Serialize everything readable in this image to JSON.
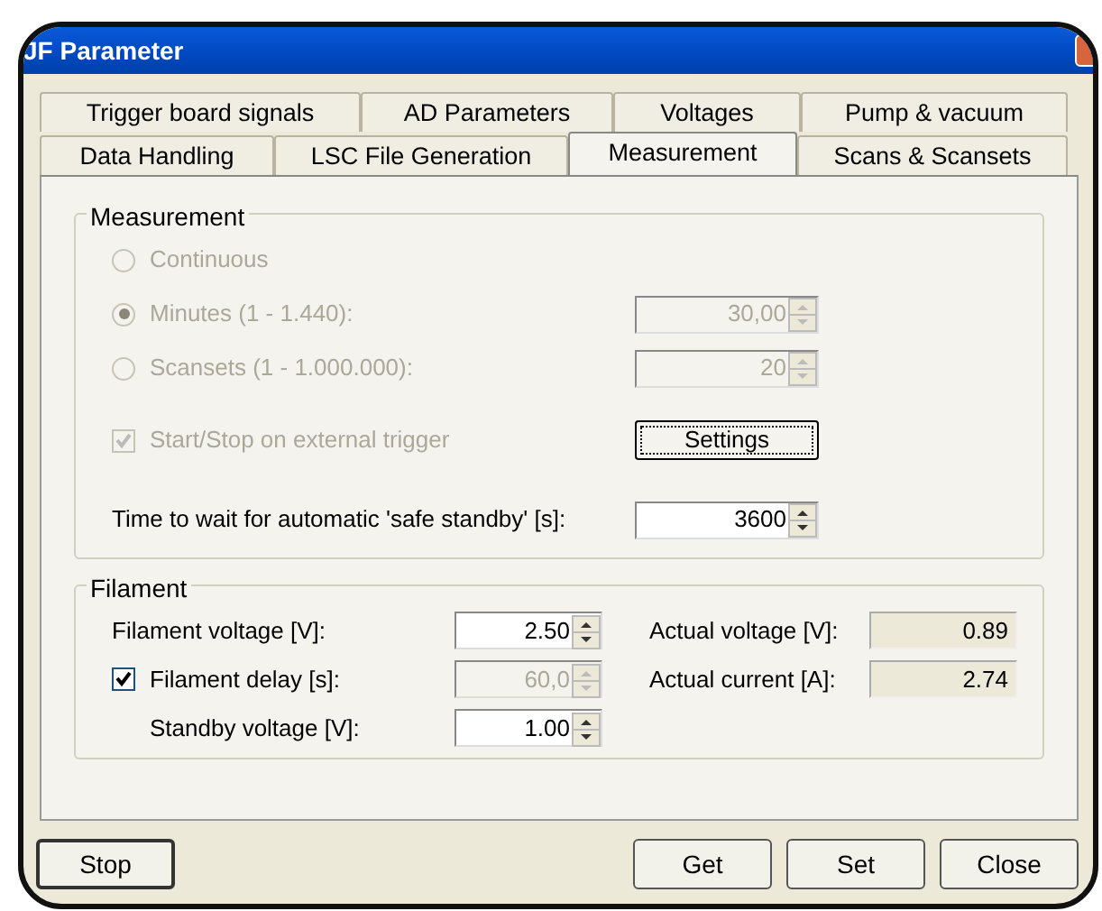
{
  "window": {
    "title": "JF Parameter"
  },
  "tab_rows": [
    [
      {
        "label": "Trigger board signals",
        "selected": false
      },
      {
        "label": "AD Parameters",
        "selected": false
      },
      {
        "label": "Voltages",
        "selected": false
      },
      {
        "label": "Pump & vacuum",
        "selected": false
      }
    ],
    [
      {
        "label": "Data Handling",
        "selected": false
      },
      {
        "label": "LSC File Generation",
        "selected": false
      },
      {
        "label": "Measurement",
        "selected": true
      },
      {
        "label": "Scans & Scansets",
        "selected": false
      }
    ]
  ],
  "measurement": {
    "title": "Measurement",
    "items": [
      {
        "kind": "radio",
        "label": "Continuous",
        "selected": false,
        "disabled": true
      },
      {
        "kind": "radio",
        "label": "Minutes (1 - 1.440):",
        "selected": true,
        "disabled": true,
        "value": "30,00"
      },
      {
        "kind": "radio",
        "label": "Scansets (1 - 1.000.000):",
        "selected": false,
        "disabled": true,
        "value": "20"
      },
      {
        "kind": "checkbox",
        "label": "Start/Stop on external trigger",
        "checked": true,
        "disabled": true,
        "button": "Settings"
      },
      {
        "kind": "spin",
        "label": "Time to wait for automatic 'safe standby' [s]:",
        "value": "3600",
        "disabled": false
      }
    ]
  },
  "filament": {
    "title": "Filament",
    "rows": [
      {
        "kind": "spin",
        "label": "Filament voltage [V]:",
        "value": "2.50",
        "disabled": false,
        "readout": {
          "label": "Actual voltage [V]:",
          "value": "0.89"
        }
      },
      {
        "kind": "checkbox",
        "label": "Filament delay [s]:",
        "checked": true,
        "value": "60,0",
        "disabled": true,
        "readout": {
          "label": "Actual current [A]:",
          "value": "2.74"
        }
      },
      {
        "kind": "spin",
        "label": "Standby voltage [V]:",
        "value": "1.00",
        "disabled": false
      }
    ]
  },
  "buttons": {
    "left": [
      "Stop"
    ],
    "right": [
      "Get",
      "Set",
      "Close"
    ]
  }
}
